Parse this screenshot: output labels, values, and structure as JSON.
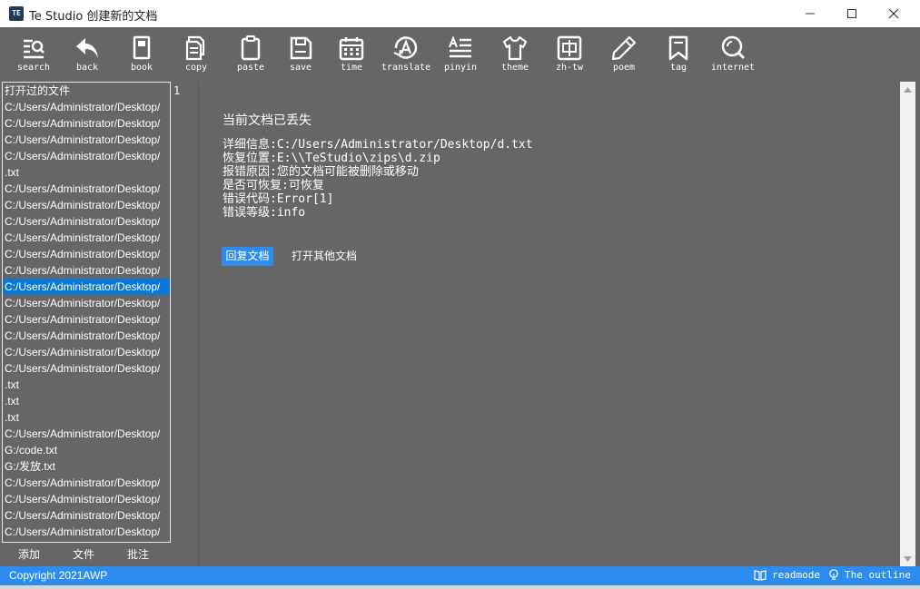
{
  "window": {
    "app_icon_text": "TE",
    "title": "Te Studio 创建新的文档"
  },
  "toolbar": [
    {
      "label": "search",
      "icon": "search-icon"
    },
    {
      "label": "back",
      "icon": "back-arrow-icon"
    },
    {
      "label": "book",
      "icon": "book-icon"
    },
    {
      "label": "copy",
      "icon": "copy-icon"
    },
    {
      "label": "paste",
      "icon": "clipboard-icon"
    },
    {
      "label": "save",
      "icon": "save-icon"
    },
    {
      "label": "time",
      "icon": "calendar-icon"
    },
    {
      "label": "translate",
      "icon": "translate-icon"
    },
    {
      "label": "pinyin",
      "icon": "pinyin-icon"
    },
    {
      "label": "theme",
      "icon": "shirt-icon"
    },
    {
      "label": "zh-tw",
      "icon": "chinese-char-icon"
    },
    {
      "label": "poem",
      "icon": "pencil-icon"
    },
    {
      "label": "tag",
      "icon": "bookmark-icon"
    },
    {
      "label": "internet",
      "icon": "globe-search-icon"
    }
  ],
  "file_panel": {
    "header": "打开过的文件",
    "items": [
      "C:/Users/Administrator/Desktop/",
      "C:/Users/Administrator/Desktop/",
      "C:/Users/Administrator/Desktop/",
      "C:/Users/Administrator/Desktop/",
      ".txt",
      "C:/Users/Administrator/Desktop/",
      "C:/Users/Administrator/Desktop/",
      "C:/Users/Administrator/Desktop/",
      "C:/Users/Administrator/Desktop/",
      "C:/Users/Administrator/Desktop/",
      "C:/Users/Administrator/Desktop/",
      "C:/Users/Administrator/Desktop/",
      "C:/Users/Administrator/Desktop/",
      "C:/Users/Administrator/Desktop/",
      "C:/Users/Administrator/Desktop/",
      "C:/Users/Administrator/Desktop/",
      "C:/Users/Administrator/Desktop/",
      ".txt",
      ".txt",
      ".txt",
      "C:/Users/Administrator/Desktop/",
      "G:/code.txt",
      "G:/发放.txt",
      "C:/Users/Administrator/Desktop/",
      "C:/Users/Administrator/Desktop/",
      "C:/Users/Administrator/Desktop/",
      "C:/Users/Administrator/Desktop/"
    ],
    "selected_index": 11,
    "tabs": [
      "添加",
      "文件",
      "批注"
    ]
  },
  "editor": {
    "line_number": "1",
    "lost_title": "当前文档已丢失",
    "details": [
      "详细信息:C:/Users/Administrator/Desktop/d.txt",
      "恢复位置:E:\\\\TeStudio\\zips\\d.zip",
      "报错原因:您的文档可能被删除或移动",
      "是否可恢复:可恢复",
      "错误代码:Error[1]",
      "错误等级:info"
    ],
    "restore_button": "回复文档",
    "open_other_button": "打开其他文档"
  },
  "statusbar": {
    "copyright": "Copyright 2021AWP",
    "readmode": "readmode",
    "outline": "The outline"
  },
  "colors": {
    "background": "#666666",
    "accent": "#2d8cf0",
    "selection": "#0a78d7"
  }
}
